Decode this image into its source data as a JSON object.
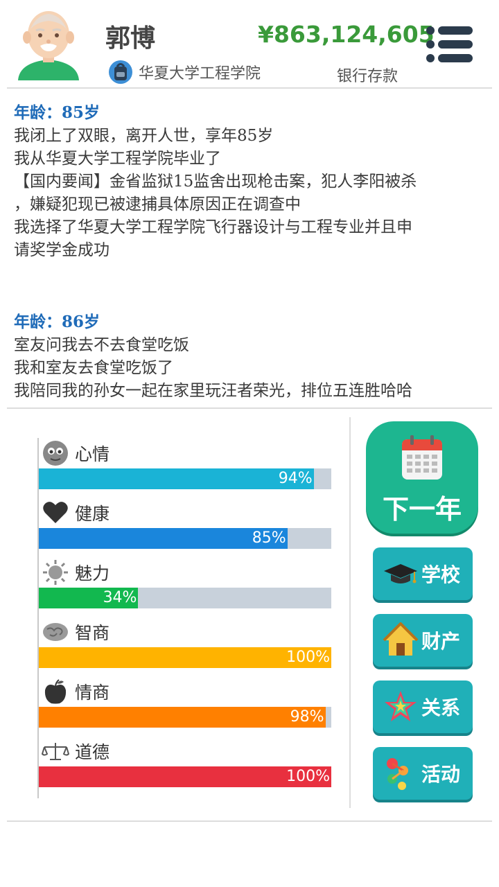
{
  "header": {
    "name": "郭博",
    "money": "¥863,124,605",
    "school": "华夏大学工程学院",
    "bank_label": "银行存款"
  },
  "log": [
    {
      "age": "年龄：85岁",
      "lines": [
        "我闭上了双眼，离开人世，享年85岁",
        "我从华夏大学工程学院毕业了",
        "【国内要闻】金省监狱15监舍出现枪击案，犯人李阳被杀",
        "，嫌疑犯现已被逮捕具体原因正在调查中",
        "我选择了华夏大学工程学院飞行器设计与工程专业并且申",
        "请奖学金成功"
      ]
    },
    {
      "age": "年龄：86岁",
      "lines": [
        "室友问我去不去食堂吃饭",
        "我和室友去食堂吃饭了",
        "我陪同我的孙女一起在家里玩汪者荣光，排位五连胜哈哈"
      ]
    }
  ],
  "stats": [
    {
      "label": "心情",
      "value": 94,
      "text": "94%",
      "color": "#1ab3d6",
      "icon": "face-icon"
    },
    {
      "label": "健康",
      "value": 85,
      "text": "85%",
      "color": "#1a86dc",
      "icon": "heart-icon"
    },
    {
      "label": "魅力",
      "value": 34,
      "text": "34%",
      "color": "#12b84f",
      "icon": "sun-icon"
    },
    {
      "label": "智商",
      "value": 100,
      "text": "100%",
      "color": "#ffb300",
      "icon": "brain-icon"
    },
    {
      "label": "情商",
      "value": 98,
      "text": "98%",
      "color": "#ff8000",
      "icon": "apple-icon"
    },
    {
      "label": "道德",
      "value": 100,
      "text": "100%",
      "color": "#e8303f",
      "icon": "scale-icon"
    }
  ],
  "buttons": {
    "next_year": "下一年",
    "school": "学校",
    "property": "财产",
    "relations": "关系",
    "activity": "活动"
  }
}
